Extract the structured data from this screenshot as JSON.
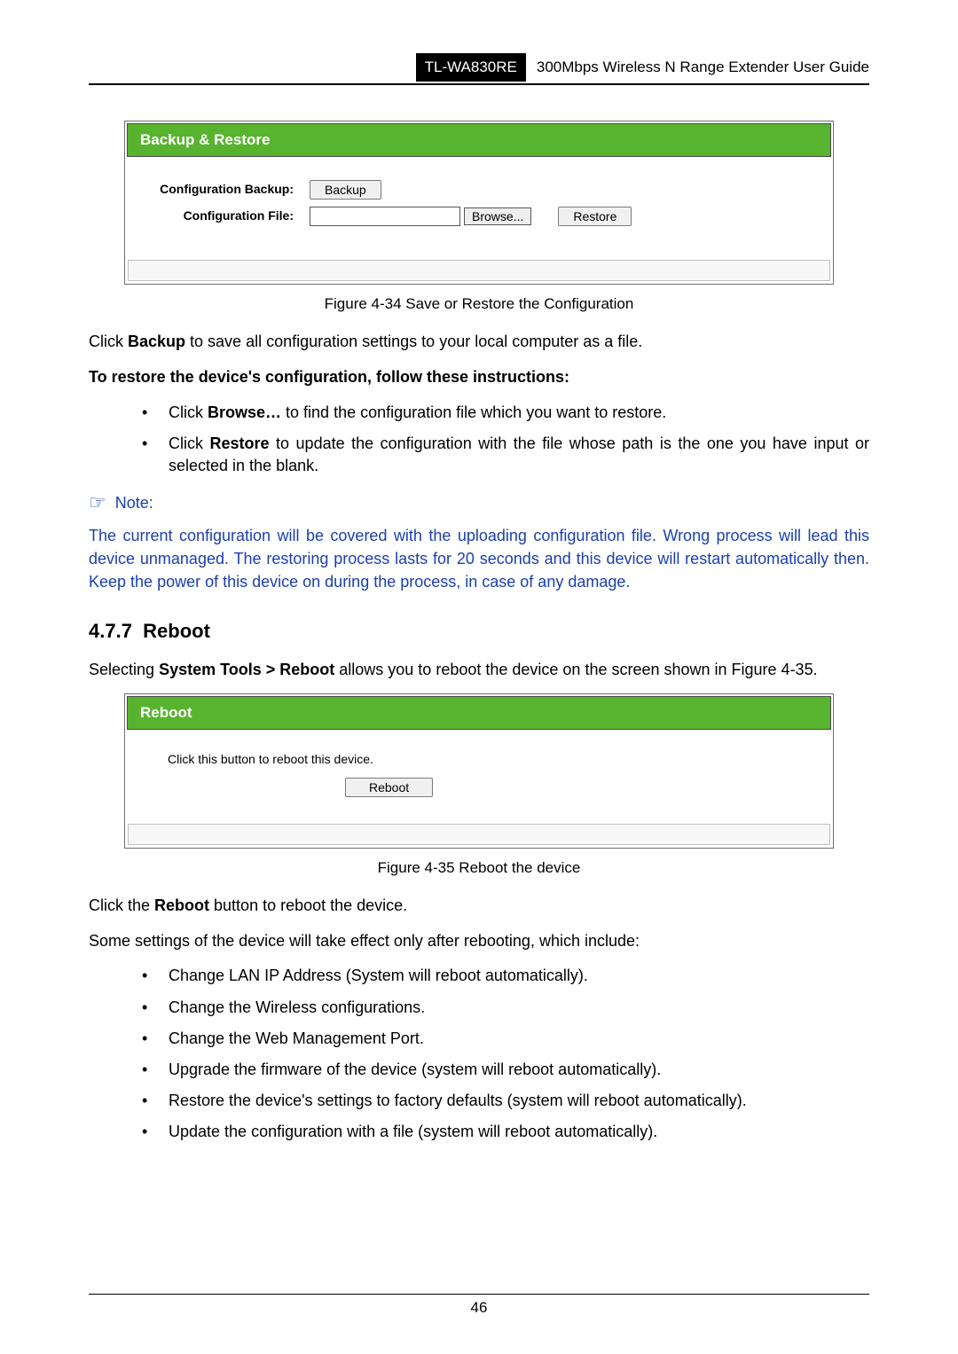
{
  "header": {
    "model": "TL-WA830RE",
    "title": "300Mbps Wireless N Range Extender User Guide"
  },
  "figure1": {
    "panel_title": "Backup & Restore",
    "row1_label": "Configuration Backup:",
    "row1_button": "Backup",
    "row2_label": "Configuration File:",
    "row2_browse": "Browse...",
    "row2_restore": "Restore",
    "caption": "Figure 4-34 Save or Restore the Configuration"
  },
  "text": {
    "p1_pre": "Click ",
    "p1_bold": "Backup",
    "p1_post": " to save all configuration settings to your local computer as a file.",
    "p2": "To restore the device's configuration, follow these instructions:",
    "li1_pre": "Click ",
    "li1_bold": "Browse…",
    "li1_post": " to find the configuration file which you want to restore.",
    "li2_pre": "Click ",
    "li2_bold": "Restore",
    "li2_post": " to update the configuration with the file whose path is the one you have input or selected in the blank.",
    "note_label": "Note:",
    "note_body": "The current configuration will be covered with the uploading configuration file. Wrong process will lead this device unmanaged. The restoring process lasts for 20 seconds and this device will restart automatically then. Keep the power of this device on during the process, in case of any damage.",
    "section_num": "4.7.7",
    "section_title": "Reboot",
    "p3_pre": "Selecting ",
    "p3_bold": "System Tools > Reboot",
    "p3_post": " allows you to reboot the device on the screen shown in Figure 4-35."
  },
  "figure2": {
    "panel_title": "Reboot",
    "instruction": "Click this button to reboot this device.",
    "button": "Reboot",
    "caption": "Figure 4-35 Reboot the device"
  },
  "after": {
    "p4_pre": "Click the ",
    "p4_bold": "Reboot",
    "p4_post": " button to reboot the device.",
    "p5": "Some settings of the device will take effect only after rebooting, which include:",
    "items": [
      "Change LAN IP Address (System will reboot automatically).",
      "Change the Wireless configurations.",
      "Change the Web Management Port.",
      "Upgrade the firmware of the device (system will reboot automatically).",
      "Restore the device's settings to factory defaults (system will reboot automatically).",
      "Update the configuration with a file (system will reboot automatically)."
    ]
  },
  "page_number": "46"
}
